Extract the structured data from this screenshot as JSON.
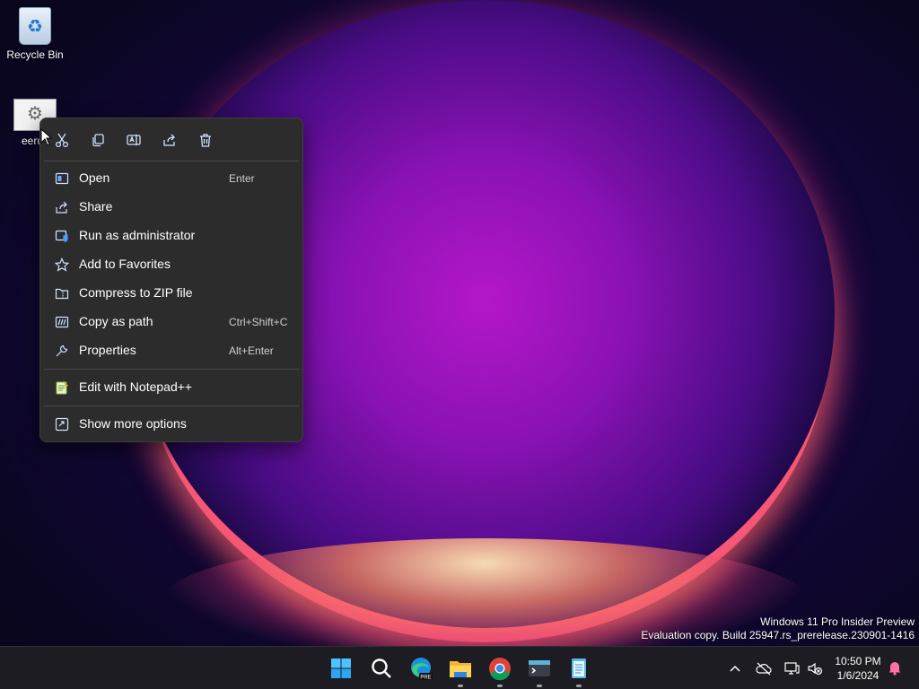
{
  "desktop": {
    "icons": [
      {
        "label": "Recycle Bin",
        "icon": "recycle-bin-icon"
      },
      {
        "label": "eeru",
        "icon": "settings-file-icon"
      }
    ]
  },
  "context_menu": {
    "toolbar": [
      "cut-icon",
      "copy-icon",
      "rename-icon",
      "share-icon",
      "delete-icon"
    ],
    "items": [
      {
        "label": "Open",
        "shortcut": "Enter",
        "icon": "open-icon"
      },
      {
        "label": "Share",
        "shortcut": "",
        "icon": "share-icon"
      },
      {
        "label": "Run as administrator",
        "shortcut": "",
        "icon": "shield-icon"
      },
      {
        "label": "Add to Favorites",
        "shortcut": "",
        "icon": "star-icon"
      },
      {
        "label": "Compress to ZIP file",
        "shortcut": "",
        "icon": "zip-icon"
      },
      {
        "label": "Copy as path",
        "shortcut": "Ctrl+Shift+C",
        "icon": "path-icon"
      },
      {
        "label": "Properties",
        "shortcut": "Alt+Enter",
        "icon": "wrench-icon"
      },
      {
        "label": "Edit with Notepad++",
        "shortcut": "",
        "icon": "notepadpp-icon"
      },
      {
        "label": "Show more options",
        "shortcut": "",
        "icon": "more-options-icon"
      }
    ]
  },
  "watermark": {
    "line1": "Windows 11 Pro Insider Preview",
    "line2": "Evaluation copy. Build 25947.rs_prerelease.230901-1416"
  },
  "taskbar": {
    "apps": [
      "start-icon",
      "search-icon",
      "edge-icon",
      "file-explorer-icon",
      "chrome-icon",
      "terminal-icon",
      "notepad-icon"
    ],
    "clock_time": "10:50 PM",
    "clock_date": "1/6/2024"
  },
  "colors": {
    "accent": "#4cc2ff",
    "menu_bg": "#2c2c2c"
  }
}
